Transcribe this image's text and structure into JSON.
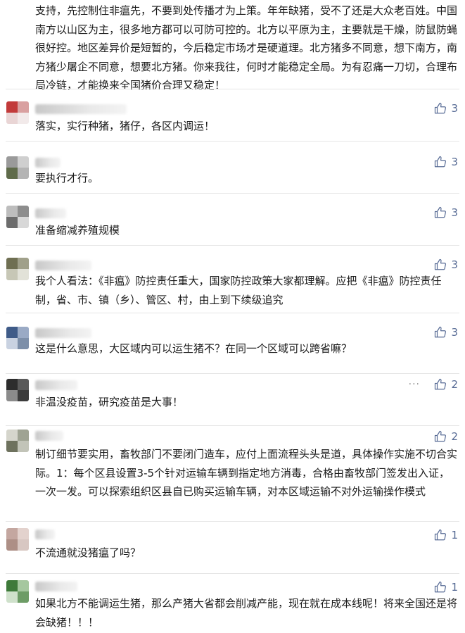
{
  "top_comment": {
    "text": "支持，先控制住非瘟先，不要到处传播才为上策。年年缺猪，受不了还是大众老百姓。中国南方以山区为主，很多地方都可以可防可控的。北方以平原为主，主要就是干燥，防鼠防蝇很好控。地区差异价是短暂的，今后稳定市场才是硬道理。北方猪多不同意，想下南方，南方猪少屠企不同意，想要北方猪。你来我往，何时才能稳定全局。为有忍痛一刀切，合理布局冷链，才能换来全国猪价合理又稳定！"
  },
  "comments": [
    {
      "text": "落实，实行种猪，猪仔，各区内调运！",
      "likes": "3"
    },
    {
      "text": "要执行才行。",
      "likes": "3"
    },
    {
      "text": "准备缩减养殖规模",
      "likes": "3"
    },
    {
      "text": "我个人看法：《非瘟》防控责任重大，国家防控政策大家都理解。应把《非瘟》防控责任制，省、市、镇（乡）、管区、村，由上到下续级追究",
      "likes": "3"
    },
    {
      "text": "这是什么意思，大区域内可以运生猪不？在同一个区域可以跨省嘛？",
      "likes": "3"
    },
    {
      "text": "非温没疫苗，研究疫苗是大事！",
      "likes": "2",
      "more": "···"
    },
    {
      "text": "制订细节要实用，畜牧部门不要闭门造车，应付上面流程头头是道，具体操作实施不切合实际。1：每个区县设置3-5个针对运输车辆到指定地方消毒，合格由畜牧部门签发出入证，一次一发。可以探索组织区县自已购买运输车辆，对本区域运输不对外运输操作模式",
      "likes": "2"
    },
    {
      "text": "不流通就没猪瘟了吗？",
      "likes": "1"
    },
    {
      "text": "如果北方不能调运生猪，那么产猪大省都会削减产能，现在就在成本线呢！将来全国还是将会缺猪！！！",
      "likes": "1"
    }
  ],
  "colors": {
    "like_blue": "#576b95",
    "divider": "#e6e6e6"
  }
}
